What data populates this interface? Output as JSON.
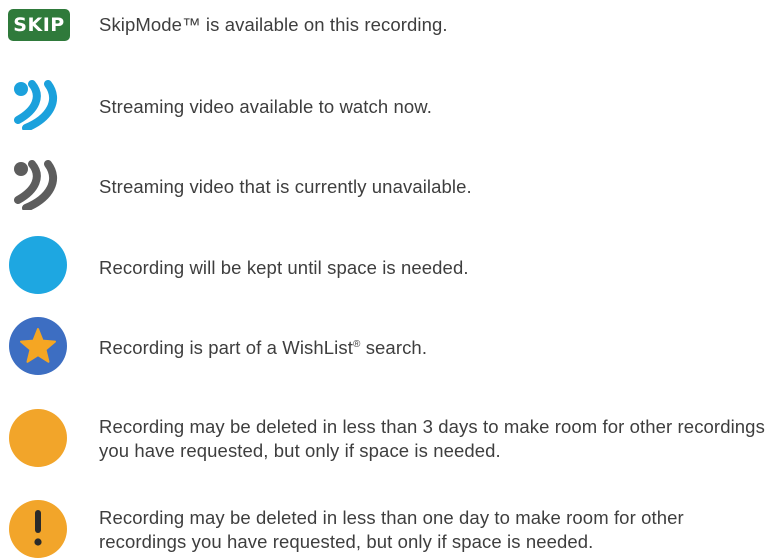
{
  "legend": {
    "items": [
      {
        "icon": "skip-icon",
        "badge_text": "SKIP",
        "description": "SkipMode™ is available on this recording.",
        "color": "#2f7a3b"
      },
      {
        "icon": "streaming-available-icon",
        "description": "Streaming video available to watch now.",
        "color": "#1ba1dc"
      },
      {
        "icon": "streaming-unavailable-icon",
        "description": "Streaming video that is currently unavailable.",
        "color": "#5d5d5d"
      },
      {
        "icon": "blue-dot-icon",
        "description": "Recording will be kept until space is needed.",
        "color": "#1ea7e1"
      },
      {
        "icon": "wishlist-star-icon",
        "description_before": "Recording is part of a WishList",
        "description_mark": "®",
        "description_after": " search.",
        "color": "#3d6ec2",
        "star_color": "#f5a623"
      },
      {
        "icon": "yellow-dot-icon",
        "description": "Recording may be deleted in less than 3 days to make room for other recordings you have requested, but only if space is needed.",
        "color": "#f2a52a"
      },
      {
        "icon": "yellow-exclamation-icon",
        "description": "Recording may be deleted in less than one day to make room for other recordings you have requested, but only if space is needed.",
        "color": "#f2a52a"
      }
    ]
  }
}
